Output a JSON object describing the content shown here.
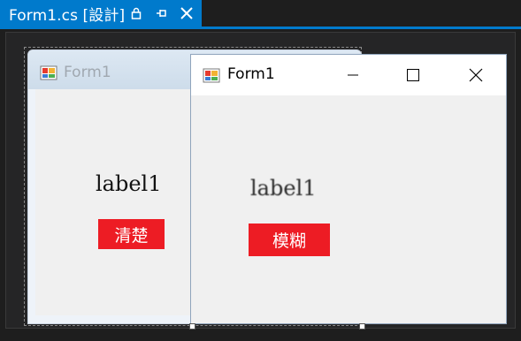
{
  "tab": {
    "title": "Form1.cs [設計]",
    "icons": [
      "lock-icon",
      "pin-icon",
      "close-icon"
    ]
  },
  "back_form": {
    "title": "Form1",
    "label": "label1",
    "button_label": "清楚"
  },
  "front_form": {
    "title": "Form1",
    "label": "label1",
    "button_label": "模糊",
    "window_buttons": [
      "minimize-icon",
      "maximize-icon",
      "close-icon"
    ]
  },
  "colors": {
    "accent": "#007acc",
    "button_red": "#ed1c24",
    "ide_background": "#1e1e1e"
  }
}
